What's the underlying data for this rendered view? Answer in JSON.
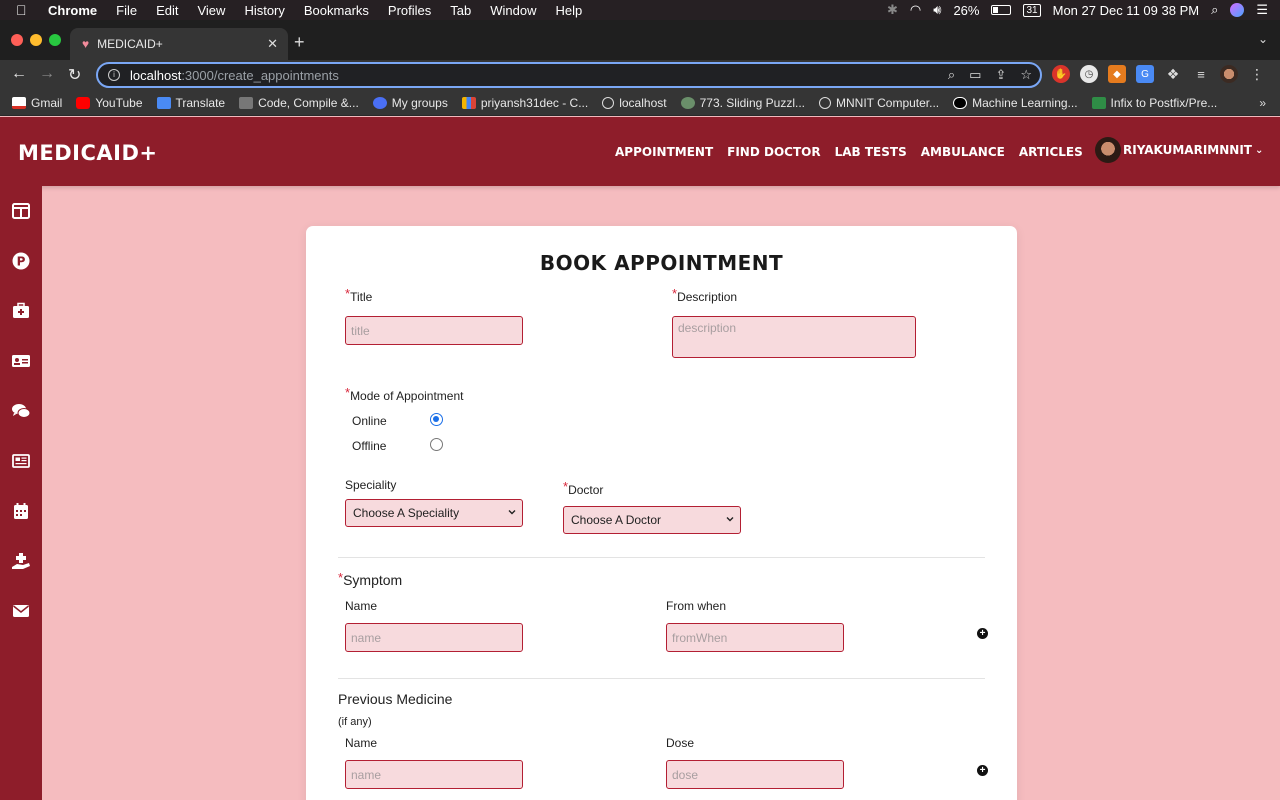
{
  "menubar": {
    "app": "Chrome",
    "items": [
      "File",
      "Edit",
      "View",
      "History",
      "Bookmarks",
      "Profiles",
      "Tab",
      "Window",
      "Help"
    ],
    "battery": "26%",
    "datetime": "Mon 27 Dec  11 09 38 PM"
  },
  "tab": {
    "title": "MEDICAID+"
  },
  "omnibox": {
    "host": "localhost",
    "path": ":3000/create_appointments"
  },
  "bookmarks": [
    "Gmail",
    "YouTube",
    "Translate",
    "Code, Compile &...",
    "My groups",
    "priyansh31dec - C...",
    "localhost",
    "773. Sliding Puzzl...",
    "MNNIT Computer...",
    "Machine Learning...",
    "Infix to Postfix/Pre..."
  ],
  "app": {
    "logo": "MEDICAID+",
    "nav": [
      "APPOINTMENT",
      "FIND DOCTOR",
      "LAB TESTS",
      "AMBULANCE",
      "ARTICLES"
    ],
    "user": "RIYAKUMARIMNNIT"
  },
  "sidebar_icons": [
    "dashboard-icon",
    "parking-p-icon",
    "medical-kit-icon",
    "id-card-icon",
    "comments-icon",
    "newspaper-icon",
    "calendar-icon",
    "hand-holding-medical-icon",
    "envelope-icon"
  ],
  "form": {
    "heading": "BOOK APPOINTMENT",
    "required_mark": "*",
    "title_label": "Title",
    "title_placeholder": "title",
    "description_label": "Description",
    "description_placeholder": "description",
    "mode_label": "Mode of Appointment",
    "mode_online": "Online",
    "mode_offline": "Offline",
    "mode_selected": "Online",
    "speciality_label": "Speciality",
    "speciality_value": "Choose A Speciality",
    "doctor_label": "Doctor",
    "doctor_value": "Choose A Doctor",
    "symptom_section": "Symptom",
    "symptom_name_label": "Name",
    "symptom_name_placeholder": "name",
    "symptom_from_label": "From when",
    "symptom_from_placeholder": "fromWhen",
    "medicine_section": "Previous Medicine",
    "medicine_note": "(if any)",
    "medicine_name_label": "Name",
    "medicine_name_placeholder": "name",
    "medicine_dose_label": "Dose",
    "medicine_dose_placeholder": "dose"
  },
  "colors": {
    "brand": "#8e1d2a",
    "page_bg": "#f5bcbf",
    "field_bg": "#f7dadd",
    "field_border": "#b31f33",
    "required": "#d8263a"
  }
}
